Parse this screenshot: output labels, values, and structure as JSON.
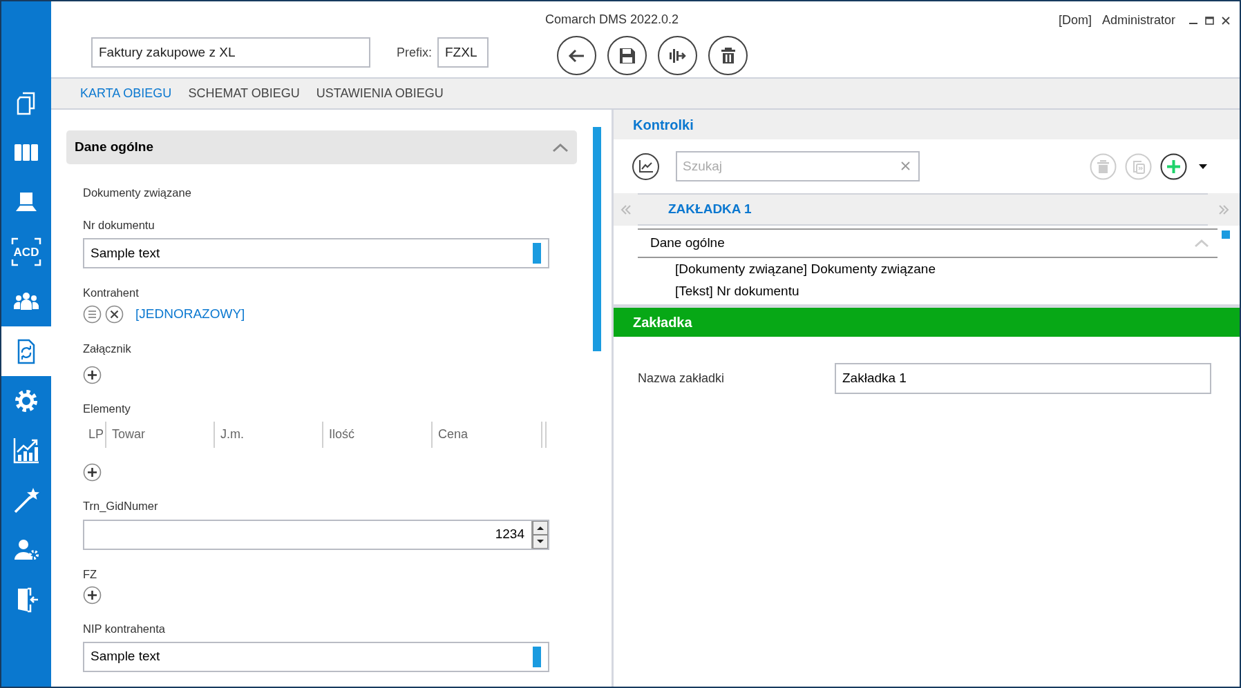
{
  "window": {
    "title": "Comarch DMS 2022.0.2",
    "domain": "[Dom]",
    "user": "Administrator"
  },
  "sidebar": {
    "items": [
      {
        "kind": "documents",
        "selected": false
      },
      {
        "kind": "binders",
        "selected": false
      },
      {
        "kind": "scanner",
        "selected": false
      },
      {
        "kind": "ocr",
        "label": "ACD",
        "selected": false
      },
      {
        "kind": "people",
        "selected": false
      },
      {
        "kind": "workflow",
        "selected": true
      },
      {
        "kind": "settings",
        "selected": false
      },
      {
        "kind": "chart",
        "selected": false
      },
      {
        "kind": "wand",
        "selected": false
      },
      {
        "kind": "user-settings",
        "selected": false
      },
      {
        "kind": "exit",
        "selected": false
      }
    ]
  },
  "header": {
    "name_field": {
      "value": "Faktury zakupowe z XL"
    },
    "prefix_label": "Prefix:",
    "prefix_field": {
      "value": "FZXL"
    },
    "toolbar": [
      {
        "kind": "back"
      },
      {
        "kind": "save"
      },
      {
        "kind": "workflow"
      },
      {
        "kind": "delete"
      }
    ]
  },
  "tabs": [
    {
      "label": "KARTA OBIEGU",
      "selected": true
    },
    {
      "label": "SCHEMAT OBIEGU",
      "selected": false
    },
    {
      "label": "USTAWIENIA OBIEGU",
      "selected": false
    }
  ],
  "form": {
    "section": {
      "title": "Dane ogólne",
      "expanded": true
    },
    "fields": [
      {
        "kind": "info",
        "label": "Dokumenty związane"
      },
      {
        "kind": "text",
        "label": "Nr dokumentu",
        "value": "Sample text",
        "required": true
      },
      {
        "kind": "contractor",
        "label": "Kontrahent",
        "value": "[JEDNORAZOWY]"
      },
      {
        "kind": "attachment",
        "label": "Załącznik"
      },
      {
        "kind": "table",
        "label": "Elementy",
        "columns": [
          "LP",
          "Towar",
          "J.m.",
          "Ilość",
          "Cena"
        ]
      },
      {
        "kind": "number",
        "label": "Trn_GidNumer",
        "value": "1234"
      },
      {
        "kind": "attachment",
        "label": "FZ"
      },
      {
        "kind": "text",
        "label": "NIP kontrahenta",
        "value": "Sample text",
        "required": true
      }
    ]
  },
  "controls_panel": {
    "title": "Kontrolki",
    "search": {
      "placeholder": "Szukaj"
    },
    "buttons": [
      {
        "kind": "delete",
        "disabled": true
      },
      {
        "kind": "copy",
        "disabled": true
      },
      {
        "kind": "add",
        "disabled": false
      }
    ],
    "tabs": [
      {
        "label": "ZAKŁADKA 1",
        "selected": true
      }
    ],
    "tree": [
      {
        "label": "Dane ogólne",
        "expanded": true,
        "children": [
          {
            "label": "[Dokumenty związane] Dokumenty związane"
          },
          {
            "label": "[Tekst] Nr dokumentu"
          }
        ]
      }
    ]
  },
  "properties": {
    "title": "Zakładka",
    "fields": [
      {
        "label": "Nazwa zakładki",
        "value": "Zakładka 1"
      }
    ]
  }
}
